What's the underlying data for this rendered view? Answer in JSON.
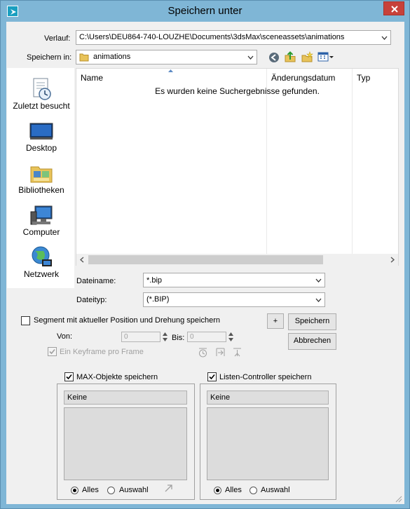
{
  "window": {
    "title": "Speichern unter"
  },
  "history": {
    "label": "Verlauf:",
    "value": "C:\\Users\\DEU864-740-LOUZHE\\Documents\\3dsMax\\sceneassets\\animations"
  },
  "save_in": {
    "label": "Speichern in:",
    "value": "animations"
  },
  "places": [
    {
      "label": "Zuletzt besucht",
      "icon": "recent-places-icon"
    },
    {
      "label": "Desktop",
      "icon": "desktop-icon"
    },
    {
      "label": "Bibliotheken",
      "icon": "libraries-icon"
    },
    {
      "label": "Computer",
      "icon": "computer-icon"
    },
    {
      "label": "Netzwerk",
      "icon": "network-icon"
    }
  ],
  "file_list": {
    "columns": [
      "Name",
      "Änderungsdatum",
      "Typ"
    ],
    "empty_message": "Es wurden keine Suchergebnisse gefunden."
  },
  "filename": {
    "label": "Dateiname:",
    "value": "*.bip"
  },
  "filetype": {
    "label": "Dateityp:",
    "value": "(*.BIP)"
  },
  "segment": {
    "checkbox_label": "Segment mit aktueller Position und Drehung speichern",
    "checked": false,
    "from_label": "Von:",
    "from_value": "0",
    "to_label": "Bis:",
    "to_value": "0",
    "keyframe_label": "Ein Keyframe pro Frame",
    "keyframe_checked": true
  },
  "buttons": {
    "plus": "+",
    "save": "Speichern",
    "cancel": "Abbrechen"
  },
  "max_objects": {
    "checkbox_label": "MAX-Objekte speichern",
    "checked": true,
    "list_header": "Keine",
    "radio_all": "Alles",
    "radio_selection": "Auswahl",
    "selected": "Alles"
  },
  "list_controllers": {
    "checkbox_label": "Listen-Controller speichern",
    "checked": true,
    "list_header": "Keine",
    "radio_all": "Alles",
    "radio_selection": "Auswahl",
    "selected": "Alles"
  },
  "colors": {
    "frame": "#7fb6d6",
    "close_button": "#c7413a",
    "dialog_bg": "#f0f0f0"
  }
}
